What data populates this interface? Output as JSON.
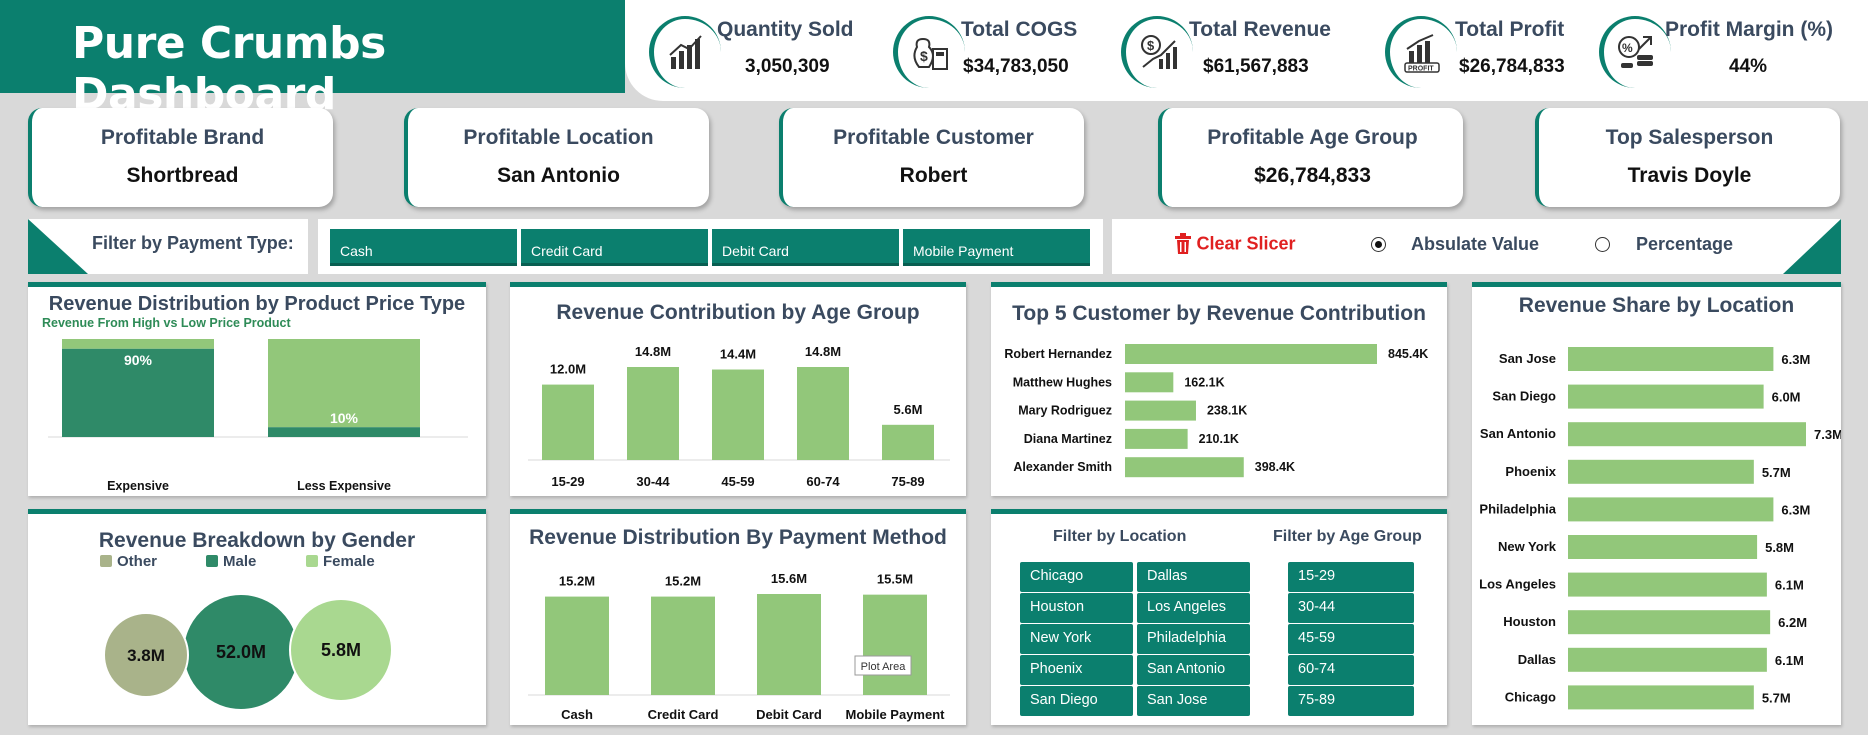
{
  "header": {
    "title": "Pure Crumbs Dashboard"
  },
  "kpis": [
    {
      "label": "Quantity Sold",
      "value": "3,050,309",
      "icon": "chart-growth-icon"
    },
    {
      "label": "Total COGS",
      "value": "$34,783,050",
      "icon": "money-calculator-icon"
    },
    {
      "label": "Total Revenue",
      "value": "$61,567,883",
      "icon": "dollar-chart-icon"
    },
    {
      "label": "Total Profit",
      "value": "$26,784,833",
      "icon": "profit-growth-icon"
    },
    {
      "label": "Profit Margin (%)",
      "value": "44%",
      "icon": "percent-coins-icon"
    }
  ],
  "cards": [
    {
      "label": "Profitable Brand",
      "value": "Shortbread"
    },
    {
      "label": "Profitable Location",
      "value": "San Antonio"
    },
    {
      "label": "Profitable Customer",
      "value": "Robert"
    },
    {
      "label": "Profitable Age Group",
      "value": "$26,784,833"
    },
    {
      "label": "Top Salesperson",
      "value": "Travis Doyle"
    }
  ],
  "filters": {
    "payment_label": "Filter by Payment Type:",
    "payment_types": [
      "Cash",
      "Credit Card",
      "Debit Card",
      "Mobile Payment"
    ],
    "clear_label": "Clear Slicer",
    "absolute_label": "Absulate Value",
    "percentage_label": "Percentage",
    "location_title": "Filter by Location",
    "locations": [
      "Chicago",
      "Dallas",
      "Houston",
      "Los Angeles",
      "New York",
      "Philadelphia",
      "Phoenix",
      "San Antonio",
      "San Diego",
      "San Jose"
    ],
    "age_title": "Filter by Age Group",
    "age_groups": [
      "15-29",
      "30-44",
      "45-59",
      "60-74",
      "75-89"
    ]
  },
  "colors": {
    "brand": "#0b7f6e",
    "bar_green": "#92c77a",
    "dark_green": "#2f8a68",
    "light_green": "#92c77a",
    "other_gray": "#a9b38a"
  },
  "chart_data": [
    {
      "type": "bar",
      "title": "Revenue Distribution by Product Price Type",
      "subtitle": "Revenue From High vs Low Price Product",
      "categories": [
        "Expensive",
        "Less Expensive"
      ],
      "values": [
        90,
        10
      ],
      "labels": [
        "90%",
        "10%"
      ],
      "ylim": [
        0,
        100
      ]
    },
    {
      "type": "bar",
      "title": "Revenue Contribution by Age Group",
      "categories": [
        "15-29",
        "30-44",
        "45-59",
        "60-74",
        "75-89"
      ],
      "values": [
        12.0,
        14.8,
        14.4,
        14.8,
        5.6
      ],
      "labels": [
        "12.0M",
        "14.8M",
        "14.4M",
        "14.8M",
        "5.6M"
      ]
    },
    {
      "type": "bar",
      "title": "Top 5 Customer by Revenue Contribution",
      "categories": [
        "Robert Hernandez",
        "Matthew Hughes",
        "Mary Rodriguez",
        "Diana Martinez",
        "Alexander Smith"
      ],
      "values": [
        845.4,
        162.1,
        238.1,
        210.1,
        398.4
      ],
      "labels": [
        "845.4K",
        "162.1K",
        "238.1K",
        "210.1K",
        "398.4K"
      ]
    },
    {
      "type": "bar",
      "title": "Revenue Share by Location",
      "categories": [
        "San Jose",
        "San Diego",
        "San Antonio",
        "Phoenix",
        "Philadelphia",
        "New York",
        "Los Angeles",
        "Houston",
        "Dallas",
        "Chicago"
      ],
      "values": [
        6.3,
        6.0,
        7.3,
        5.7,
        6.3,
        5.8,
        6.1,
        6.2,
        6.1,
        5.7
      ],
      "labels": [
        "6.3M",
        "6.0M",
        "7.3M",
        "5.7M",
        "6.3M",
        "5.8M",
        "6.1M",
        "6.2M",
        "6.1M",
        "5.7M"
      ]
    },
    {
      "type": "scatter",
      "title": "Revenue Breakdown by Gender",
      "series": [
        {
          "name": "Other",
          "values": [
            3.8
          ],
          "label": "3.8M"
        },
        {
          "name": "Male",
          "values": [
            52.0
          ],
          "label": "52.0M"
        },
        {
          "name": "Female",
          "values": [
            5.8
          ],
          "label": "5.8M"
        }
      ]
    },
    {
      "type": "bar",
      "title": "Revenue Distribution By Payment Method",
      "categories": [
        "Cash",
        "Credit Card",
        "Debit Card",
        "Mobile Payment"
      ],
      "values": [
        15.2,
        15.2,
        15.6,
        15.5
      ],
      "labels": [
        "15.2M",
        "15.2M",
        "15.6M",
        "15.5M"
      ],
      "tooltip": "Plot Area"
    }
  ]
}
